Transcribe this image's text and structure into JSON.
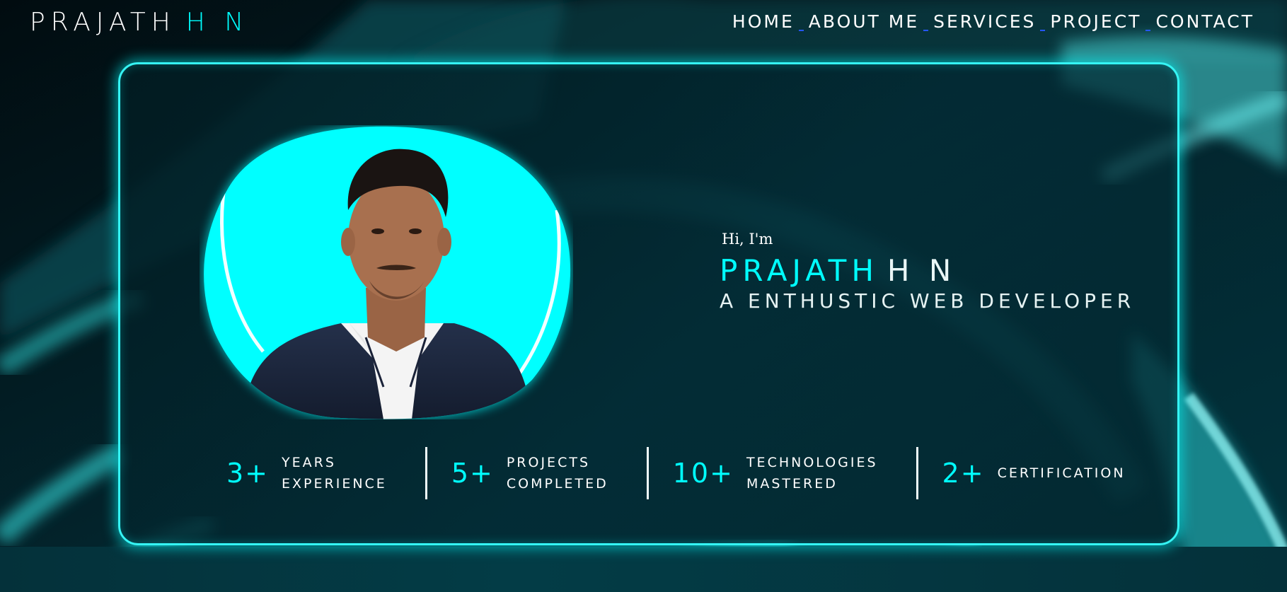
{
  "header": {
    "logo_first": "PRAJATH",
    "logo_last": "H N",
    "nav": [
      {
        "label": "HOME"
      },
      {
        "label": "ABOUT ME"
      },
      {
        "label": "SERVICES"
      },
      {
        "label": "PROJECT"
      },
      {
        "label": "CONTACT"
      }
    ]
  },
  "hero": {
    "greeting": "Hi, I'm",
    "name_first": "PRAJATH",
    "name_last": "H N",
    "tagline": "A ENTHUSTIC WEB DEVELOPER",
    "photo_icon": "profile-photo-icon"
  },
  "stats": [
    {
      "number": "3+",
      "line1": "YEARS",
      "line2": "EXPERIENCE"
    },
    {
      "number": "5+",
      "line1": "PROJECTS",
      "line2": "COMPLETED"
    },
    {
      "number": "10+",
      "line1": "TECHNOLOGIES",
      "line2": "MASTERED"
    },
    {
      "number": "2+",
      "line1": "CERTIFICATION",
      "line2": ""
    }
  ],
  "colors": {
    "accent": "#00ffff",
    "background": "#021f26",
    "text": "#ffffff",
    "nav_separator": "#2456ff"
  }
}
